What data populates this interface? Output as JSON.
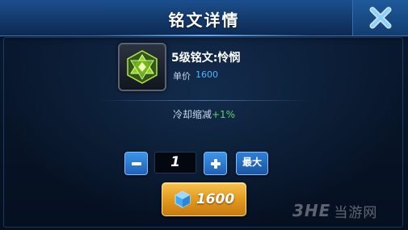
{
  "dialog": {
    "title": "铭文详情",
    "close_icon": "close-x-icon"
  },
  "rune": {
    "icon": "green-hexagram-rune-icon",
    "name": "5级铭文:怜悯",
    "price_label": "单价",
    "price_value": "1600"
  },
  "attribute": {
    "name": "冷却缩减",
    "value": "+1%"
  },
  "quantity": {
    "minus_icon": "minus-icon",
    "value": "1",
    "plus_icon": "plus-icon",
    "max_label": "最大"
  },
  "buy": {
    "currency_icon": "blue-diamond-icon",
    "total": "1600"
  },
  "watermark": {
    "logo": "3HE",
    "site": "当游网"
  },
  "colors": {
    "price_blue": "#4fb4ff",
    "attr_green": "#5fd16a",
    "buy_gold": "#e29a1f",
    "button_blue": "#2f7fd6"
  }
}
